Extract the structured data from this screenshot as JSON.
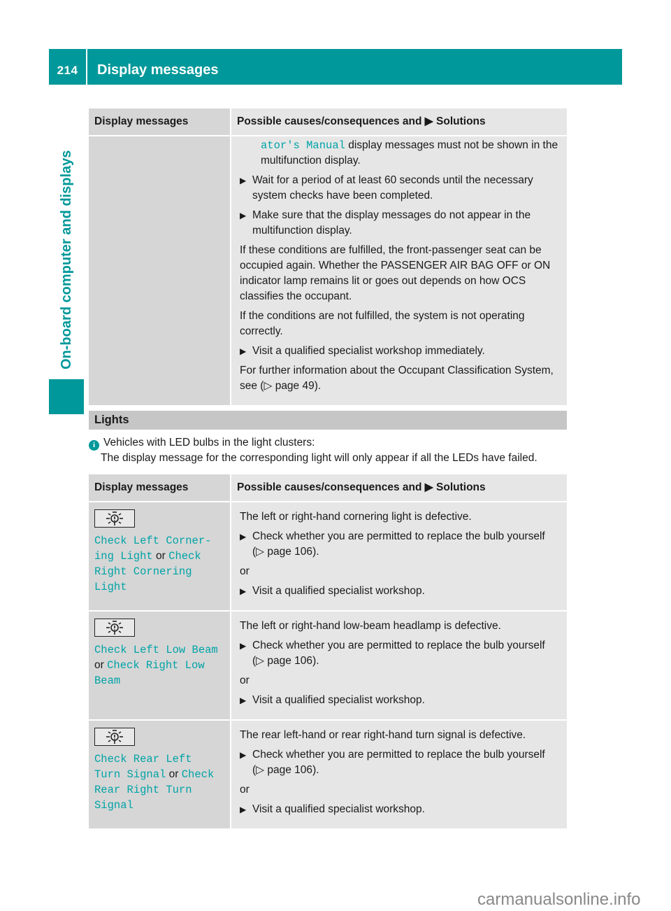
{
  "header": {
    "page_number": "214",
    "title": "Display messages"
  },
  "side_label": "On-board computer and displays",
  "colors": {
    "brand": "#00989a",
    "code_text": "#00a3a6",
    "header_cell": "#d6d6d6",
    "body_cell": "#e6e6e6",
    "section_head": "#c6c6c6"
  },
  "table1": {
    "headers": {
      "col1": "Display messages",
      "col2_prefix": "Possible causes/consequences and",
      "col2_arrow": "▶",
      "col2_suffix": "Solutions"
    },
    "row": {
      "continued_code": "ator's Manual",
      "continued_text": "display messages must not be shown in the multifunction display.",
      "bullet1": "Wait for a period of at least 60 seconds until the necessary system checks have been completed.",
      "bullet2": "Make sure that the display messages do not appear in the multifunction display.",
      "para1": "If these conditions are fulfilled, the front-passenger seat can be occupied again. Whether the PASSENGER AIR BAG OFF or ON indicator lamp remains lit or goes out depends on how OCS classifies the occupant.",
      "para2": "If the conditions are not fulfilled, the system is not operating correctly.",
      "bullet3": "Visit a qualified specialist workshop immediately.",
      "para3_prefix": "For further information about the Occupant Classification System, see (",
      "para3_ref": "▷ page 49",
      "para3_suffix": ")."
    }
  },
  "lights_section": {
    "title": "Lights",
    "info_icon": "info-icon",
    "info_line1": "Vehicles with LED bulbs in the light clusters:",
    "info_line2": "The display message for the corresponding light will only appear if all the LEDs have failed."
  },
  "table2": {
    "headers": {
      "col1": "Display messages",
      "col2_prefix": "Possible causes/consequences and",
      "col2_arrow": "▶",
      "col2_suffix": "Solutions"
    },
    "rows": [
      {
        "icon": "bulb-warning-icon",
        "msg_a": "Check Left Corner‐ing Light",
        "or": "or",
        "msg_b": "Check Right Cornering Light",
        "cause": "The left or right-hand cornering light is defective.",
        "bullet1": "Check whether you are permitted to replace the bulb yourself",
        "ref": "▷ page 106",
        "or_line": "or",
        "bullet2": "Visit a qualified specialist workshop."
      },
      {
        "icon": "bulb-warning-icon",
        "msg_a": "Check Left Low Beam",
        "or": "or",
        "msg_b": "Check Right Low Beam",
        "cause": "The left or right-hand low-beam headlamp is defective.",
        "bullet1": "Check whether you are permitted to replace the bulb yourself",
        "ref": "▷ page 106",
        "or_line": "or",
        "bullet2": "Visit a qualified specialist workshop."
      },
      {
        "icon": "bulb-warning-icon",
        "msg_a": "Check Rear Left Turn Signal",
        "or": "or",
        "msg_b": "Check Rear Right Turn Signal",
        "cause": "The rear left-hand or rear right-hand turn signal is defective.",
        "bullet1": "Check whether you are permitted to replace the bulb yourself",
        "ref": "▷ page 106",
        "or_line": "or",
        "bullet2": "Visit a qualified specialist workshop."
      }
    ]
  },
  "watermark": "carmanualsonline.info"
}
